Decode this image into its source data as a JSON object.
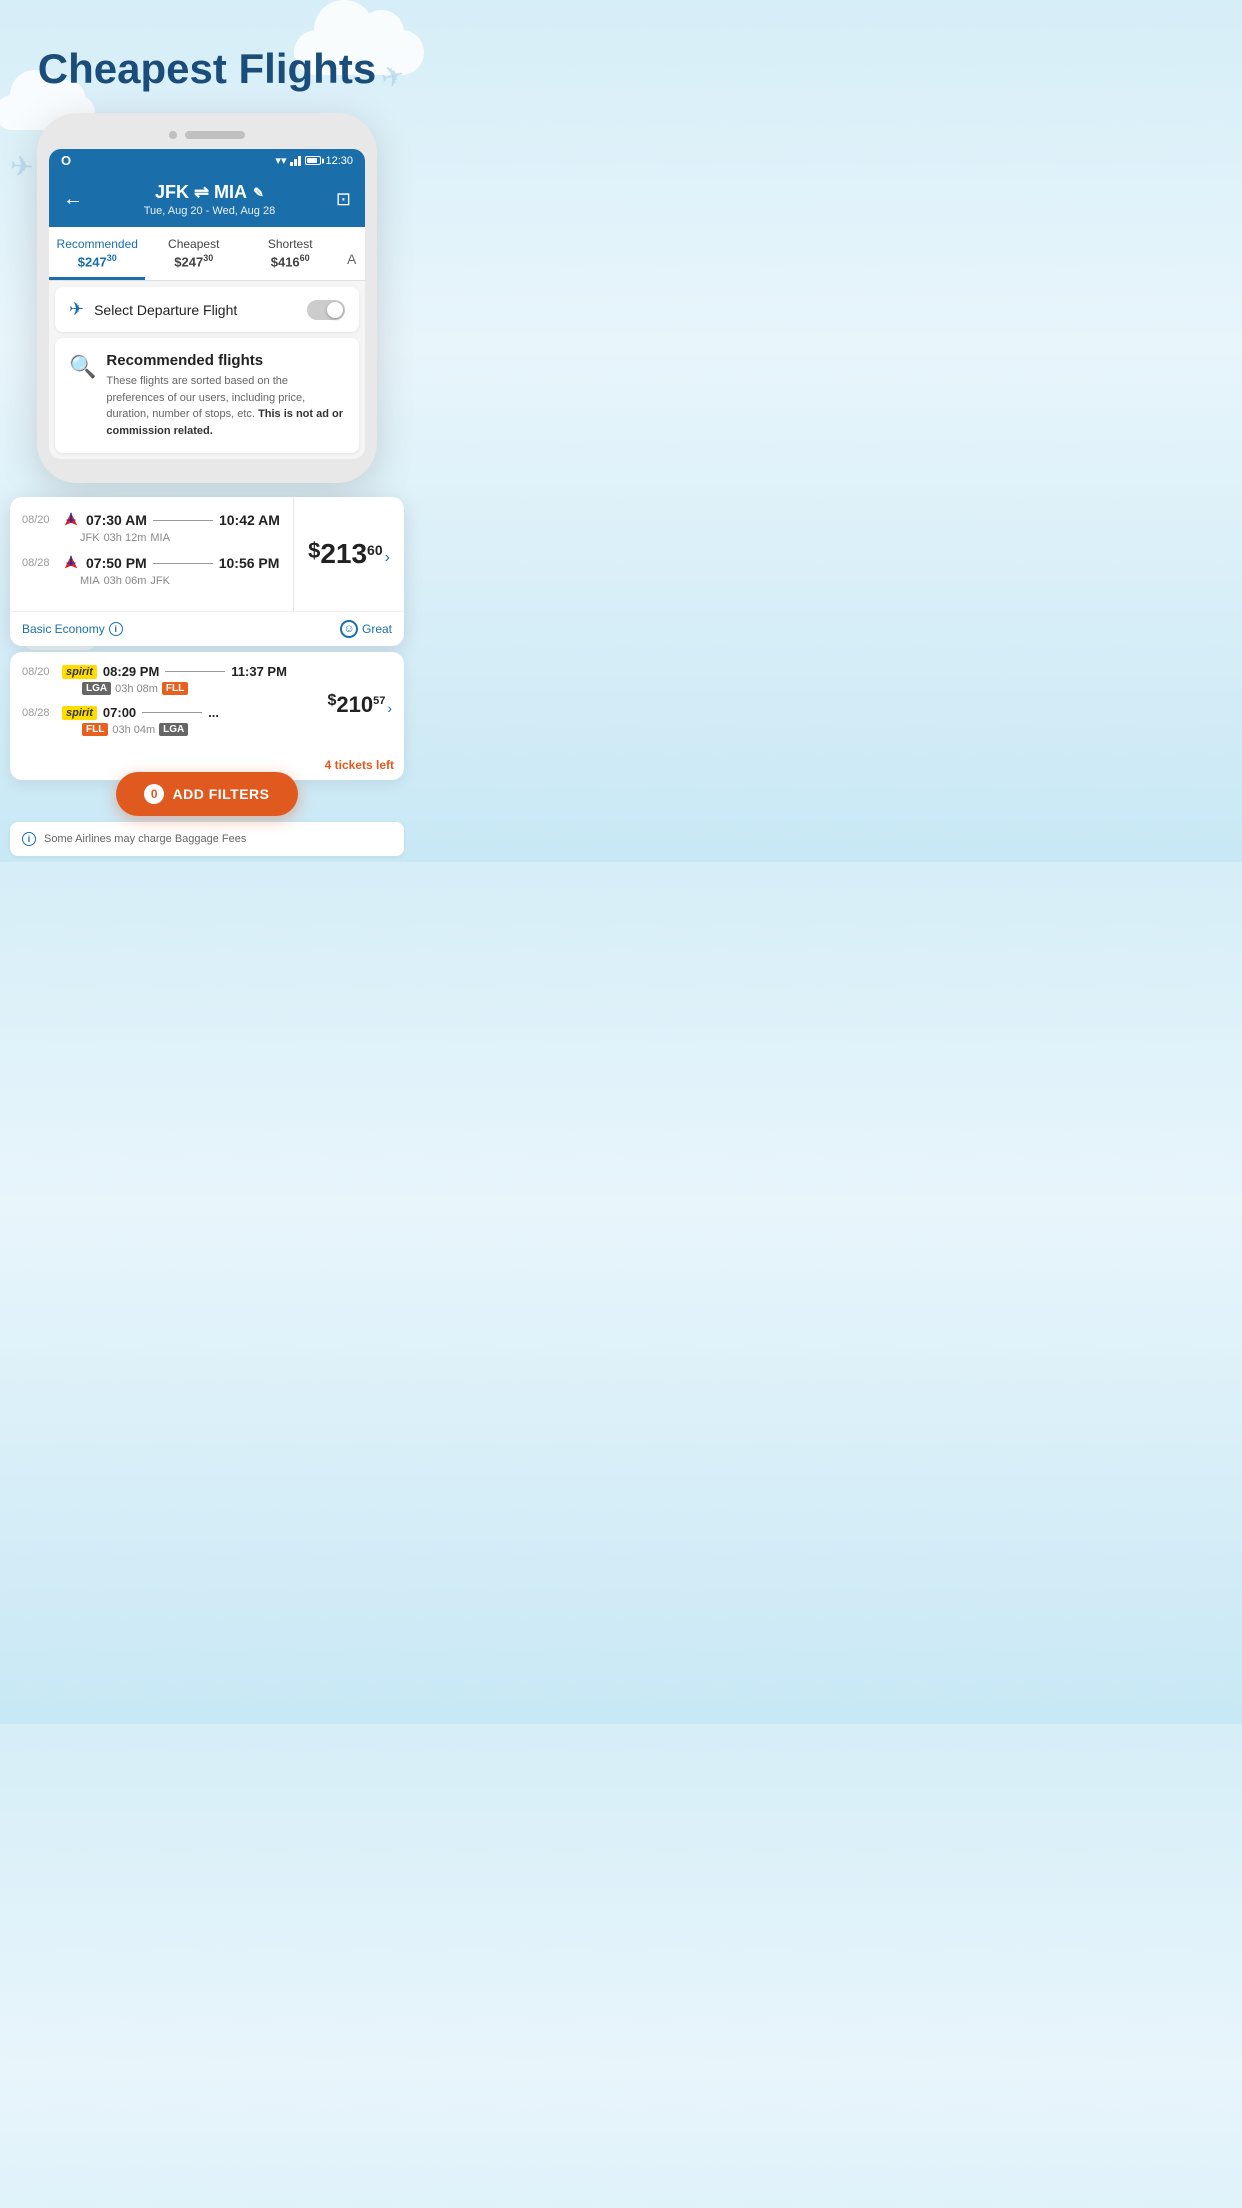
{
  "page": {
    "title": "Cheapest Flights",
    "background": "#d6eef8"
  },
  "phone": {
    "status_bar": {
      "app": "O",
      "time": "12:30"
    },
    "header": {
      "route": "JFK ⇌ MIA",
      "edit_icon": "✎",
      "dates": "Tue, Aug 20 - Wed, Aug 28",
      "back_label": "←",
      "bookmark_label": "⊡"
    },
    "tabs": [
      {
        "label": "Recommended",
        "price_main": "247",
        "price_cents": "30",
        "active": true
      },
      {
        "label": "Cheapest",
        "price_main": "247",
        "price_cents": "30",
        "active": false
      },
      {
        "label": "Shortest",
        "price_main": "416",
        "price_cents": "60",
        "active": false
      },
      {
        "label": "A",
        "price_main": "",
        "price_cents": "",
        "active": false
      }
    ],
    "select_departure": {
      "label": "Select Departure Flight",
      "toggle_on": false
    },
    "recommended": {
      "title": "Recommended flights",
      "description": "These flights are sorted based on the preferences of our users, including price, duration, number of stops, etc.",
      "disclaimer": "This is not ad or commission related."
    }
  },
  "flight_card_1": {
    "price_dollar": "$",
    "price_main": "213",
    "price_cents": "60",
    "segments": [
      {
        "date": "08/20",
        "airline": "AA",
        "dep_time": "07:30 AM",
        "arr_time": "10:42 AM",
        "dep_airport": "JFK",
        "duration": "03h 12m",
        "arr_airport": "MIA"
      },
      {
        "date": "08/28",
        "airline": "AA",
        "dep_time": "07:50 PM",
        "arr_time": "10:56 PM",
        "dep_airport": "MIA",
        "duration": "03h 06m",
        "arr_airport": "JFK"
      }
    ],
    "footer": {
      "economy_label": "Basic Economy",
      "rating_label": "Great"
    }
  },
  "flight_card_2": {
    "price_main": "210",
    "price_cents": "57",
    "segments": [
      {
        "date": "08/20",
        "airline": "spirit",
        "dep_time": "08:29 PM",
        "arr_time": "11:37 PM",
        "dep_airport_tag": "LGA",
        "duration": "03h 08m",
        "arr_airport_tag": "FLL"
      },
      {
        "date": "08/28",
        "airline": "spirit",
        "dep_time": "07:00",
        "arr_time": "...",
        "dep_airport_tag": "FLL",
        "duration": "03h 04m",
        "arr_airport_tag": "LGA"
      }
    ],
    "tickets_left": "4 tickets left"
  },
  "add_filters": {
    "badge": "0",
    "label": "ADD FILTERS"
  },
  "baggage": {
    "notice": "Some Airlines may charge Baggage Fees"
  }
}
